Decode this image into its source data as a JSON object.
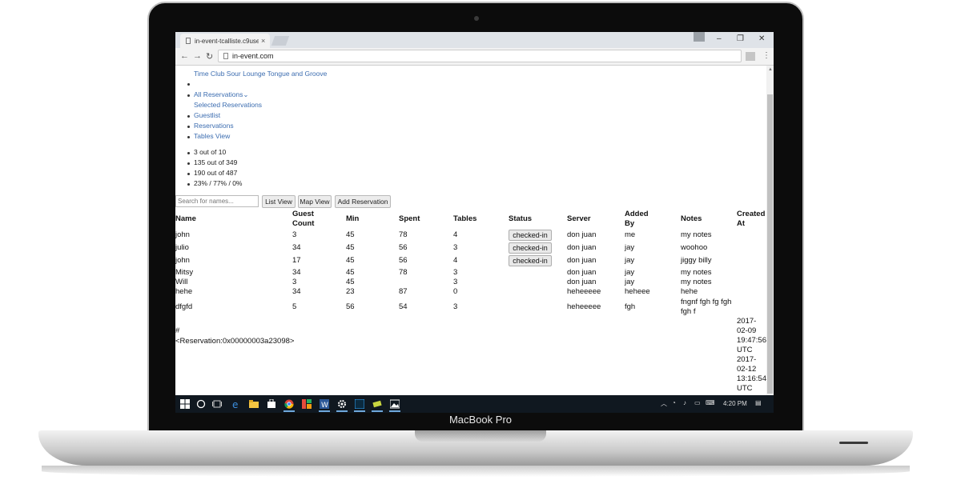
{
  "device": {
    "label": "MacBook Pro"
  },
  "browser": {
    "tab_title": "in-event-tcalliste.c9users",
    "tab_close": "×",
    "url": "in-event.com",
    "window_minimize": "–",
    "window_restore": "❐",
    "window_close": "✕"
  },
  "nav": {
    "brand": "Time Club Sour Lounge Tongue and Groove",
    "all_reservations": "All Reservations",
    "selected_reservations": "Selected Reservations",
    "guestlist": "Guestlist",
    "reservations": "Reservations",
    "tables_view": "Tables View"
  },
  "stats": [
    "3 out of 10",
    "135 out of 349",
    "190 out of 487",
    "23% / 77% / 0%"
  ],
  "toolbar": {
    "search_placeholder": "Search for names...",
    "list_view": "List View",
    "map_view": "Map View",
    "add_reservation": "Add Reservation"
  },
  "table": {
    "headers": {
      "name": "Name",
      "guest_count_1": "Guest",
      "guest_count_2": "Count",
      "min": "Min",
      "spent": "Spent",
      "tables": "Tables",
      "status": "Status",
      "server": "Server",
      "added_by_1": "Added",
      "added_by_2": "By",
      "notes": "Notes",
      "created_at_1": "Created",
      "created_at_2": "At"
    },
    "rows": [
      {
        "name": "john",
        "guests": "3",
        "min": "45",
        "spent": "78",
        "tables": "4",
        "status": "checked-in",
        "server": "don juan",
        "added_by": "me",
        "notes": "my notes"
      },
      {
        "name": "julio",
        "guests": "34",
        "min": "45",
        "spent": "56",
        "tables": "3",
        "status": "checked-in",
        "server": "don juan",
        "added_by": "jay",
        "notes": "woohoo"
      },
      {
        "name": "john",
        "guests": "17",
        "min": "45",
        "spent": "56",
        "tables": "4",
        "status": "checked-in",
        "server": "don juan",
        "added_by": "jay",
        "notes": "jiggy billy"
      },
      {
        "name": "Mitsy",
        "guests": "34",
        "min": "45",
        "spent": "78",
        "tables": "3",
        "status": "",
        "server": "don juan",
        "added_by": "jay",
        "notes": "my notes"
      },
      {
        "name": "Will",
        "guests": "3",
        "min": "45",
        "spent": "",
        "tables": "3",
        "status": "",
        "server": "don juan",
        "added_by": "jay",
        "notes": "my notes"
      },
      {
        "name": "hehe",
        "guests": "34",
        "min": "23",
        "spent": "87",
        "tables": "0",
        "status": "",
        "server": "heheeeee",
        "added_by": "heheee",
        "notes": "hehe"
      },
      {
        "name": "dfgfd",
        "guests": "5",
        "min": "56",
        "spent": "54",
        "tables": "3",
        "status": "",
        "server": "heheeeee",
        "added_by": "fgh",
        "notes_1": "fngnf fgh fg fgh",
        "notes_2": "fgh f"
      }
    ],
    "footer_hash": "#",
    "footer_object": "<Reservation:0x00000003a23098>",
    "created_1": [
      "2017-",
      "02-09",
      "19:47:56",
      "UTC"
    ],
    "created_2": [
      "2017-",
      "02-12",
      "13:16:54",
      "UTC"
    ]
  },
  "taskbar": {
    "clock": "4:20 PM"
  }
}
